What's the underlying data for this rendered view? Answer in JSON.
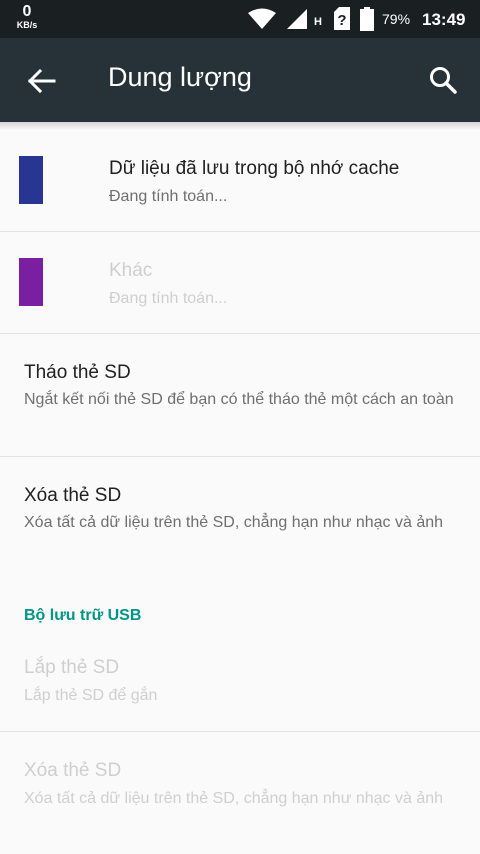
{
  "status_bar": {
    "speed_value": "0",
    "speed_unit": "KB/s",
    "battery": "79%",
    "time": "13:49",
    "network_type": "H",
    "icons": [
      "wifi-icon",
      "signal-icon",
      "sim-unknown-icon",
      "battery-icon"
    ]
  },
  "app_bar": {
    "title": "Dung lượng",
    "back_icon": "arrow-left-icon",
    "search_icon": "search-icon"
  },
  "colors": {
    "app_bar": "#263238",
    "status_bar": "#1a1f22",
    "accent": "#009688",
    "cache_swatch": "#283593",
    "other_swatch": "#7b1fa2"
  },
  "items": {
    "cache": {
      "title": "Dữ liệu đã lưu trong bộ nhớ cache",
      "summary": "Đang tính toán...",
      "enabled": true
    },
    "other": {
      "title": "Khác",
      "summary": "Đang tính toán...",
      "enabled": false
    },
    "unmount_sd": {
      "title": "Tháo thẻ SD",
      "summary": "Ngắt kết nối thẻ SD để bạn có thể tháo thẻ một cách an toàn",
      "enabled": true
    },
    "erase_sd": {
      "title": "Xóa thẻ SD",
      "summary": "Xóa tất cả dữ liệu trên thẻ SD, chẳng hạn như nhạc và ảnh",
      "enabled": true
    }
  },
  "usb_section": {
    "header": "Bộ lưu trữ USB",
    "mount_sd": {
      "title": "Lắp thẻ SD",
      "summary": "Lắp thẻ SD để gắn",
      "enabled": false
    },
    "erase_sd": {
      "title": "Xóa thẻ SD",
      "summary": "Xóa tất cả dữ liệu trên thẻ SD, chẳng hạn như nhạc và ảnh",
      "enabled": false
    }
  }
}
